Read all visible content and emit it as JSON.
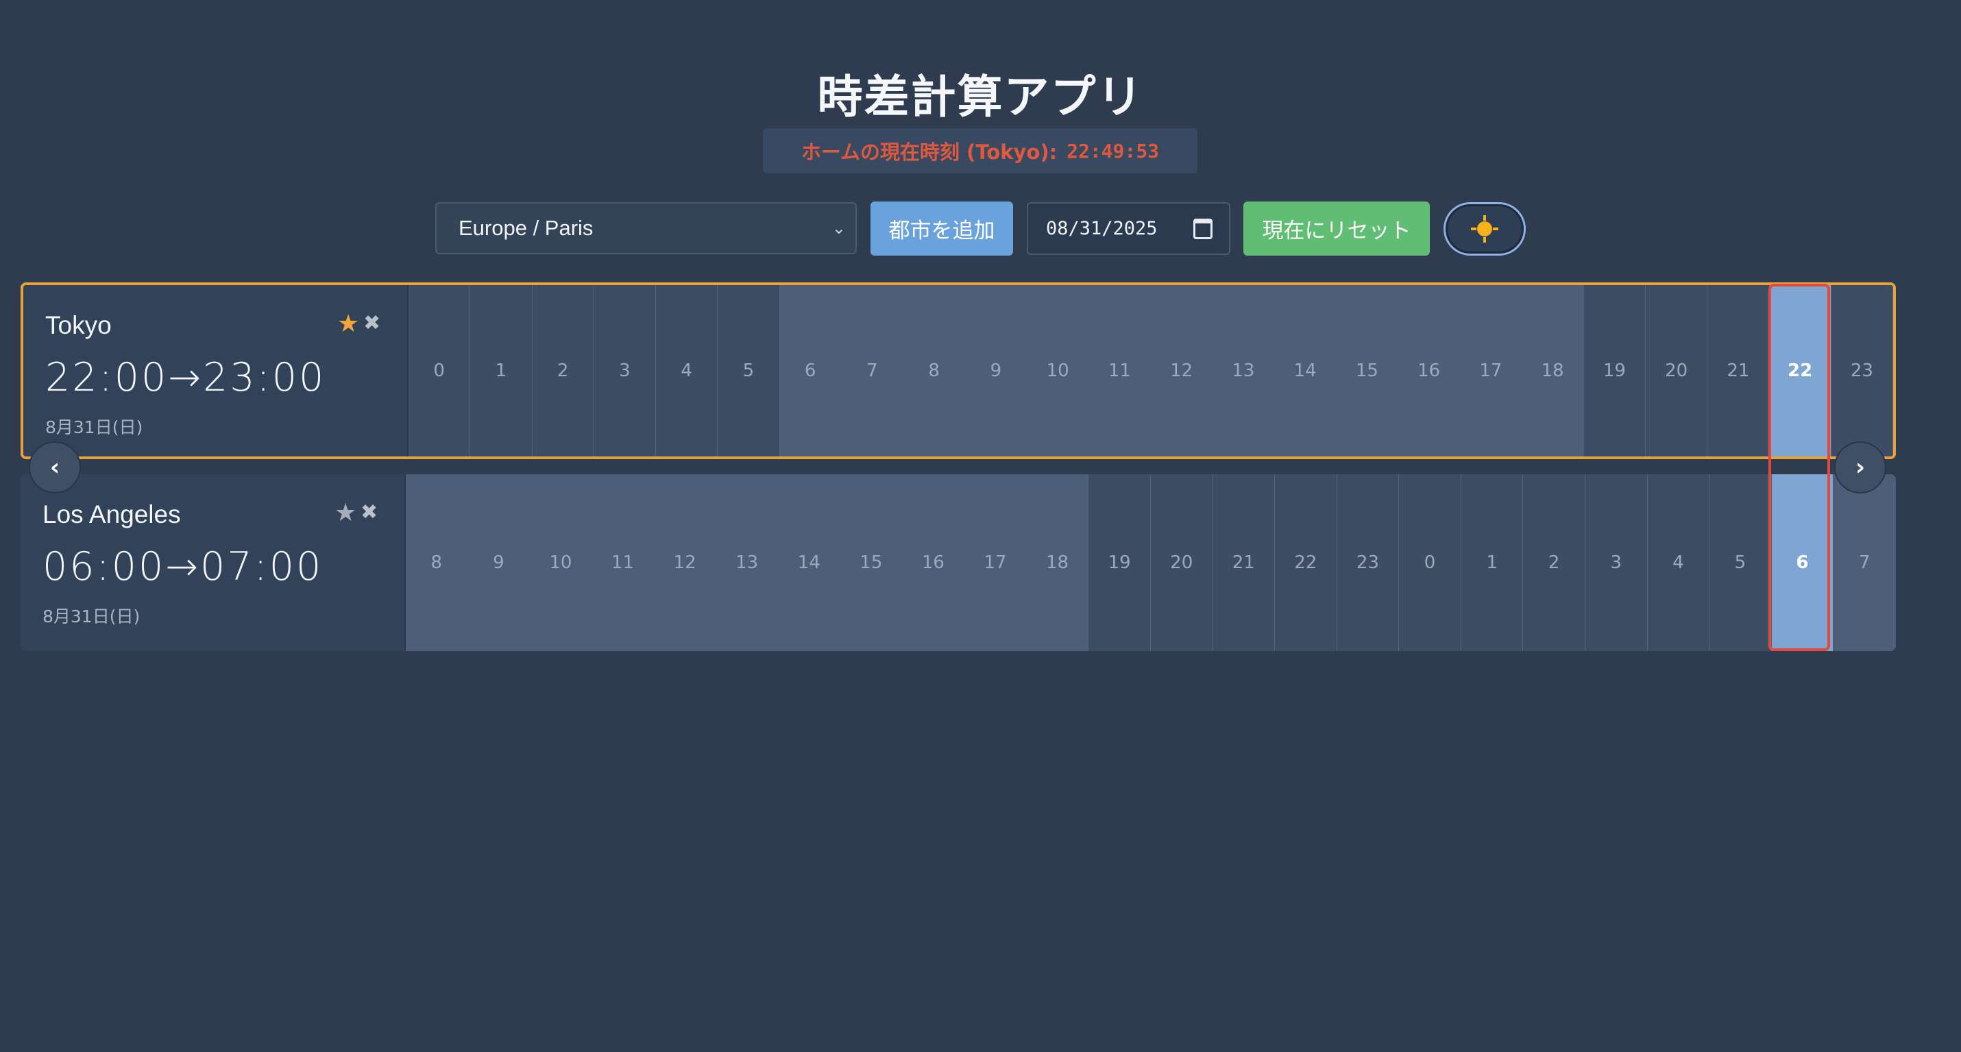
{
  "app": {
    "title": "時差計算アプリ"
  },
  "home_clock": {
    "label": "ホームの現在時刻 (Tokyo):",
    "time": "22:49:53"
  },
  "controls": {
    "timezone_select": "Europe / Paris",
    "add_city_label": "都市を追加",
    "date_value": "08/31/2025",
    "reset_label": "現在にリセット",
    "theme_icon": "sun-icon"
  },
  "nav": {
    "prev": "‹",
    "next": "›"
  },
  "cities": [
    {
      "name": "Tokyo",
      "home": true,
      "favorite": true,
      "range_start": "22:00",
      "arrow": "→",
      "range_end": "23:00",
      "date": "8月31日(日)",
      "hours": [
        "0",
        "1",
        "2",
        "3",
        "4",
        "5",
        "6",
        "7",
        "8",
        "9",
        "10",
        "11",
        "12",
        "13",
        "14",
        "15",
        "16",
        "17",
        "18",
        "19",
        "20",
        "21",
        "22",
        "23"
      ],
      "selected_hour": "22"
    },
    {
      "name": "Los Angeles",
      "home": false,
      "favorite": false,
      "range_start": "06:00",
      "arrow": "→",
      "range_end": "07:00",
      "date": "8月31日(日)",
      "hours": [
        "8",
        "9",
        "10",
        "11",
        "12",
        "13",
        "14",
        "15",
        "16",
        "17",
        "18",
        "19",
        "20",
        "21",
        "22",
        "23",
        "0",
        "1",
        "2",
        "3",
        "4",
        "5",
        "6",
        "7"
      ],
      "selected_hour": "6"
    }
  ],
  "colors": {
    "background": "#2f3c4f",
    "home_border": "#e9a23a",
    "selection_border": "#e04b3d",
    "selected_hour": "#7fa5d3",
    "add_button": "#6aa3dc",
    "reset_button": "#5fbe73",
    "favorite_star": "#f0a63a",
    "home_clock_text": "#e2583e"
  }
}
